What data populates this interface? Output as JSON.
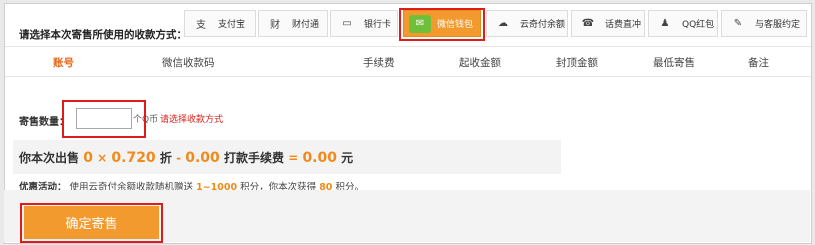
{
  "payment": {
    "label": "请选择本次寄售所使用的收款方式：",
    "options": [
      {
        "label": "支付宝",
        "icon": "alipay-icon",
        "glyph": "支"
      },
      {
        "label": "财付通",
        "icon": "tenpay-icon",
        "glyph": "财"
      },
      {
        "label": "银行卡",
        "icon": "bank-card-icon",
        "glyph": "▭"
      },
      {
        "label": "微信钱包",
        "icon": "wechat-wallet-icon",
        "glyph": "✉",
        "selected": true
      },
      {
        "label": "云奇付余额",
        "icon": "yunqifu-icon",
        "glyph": "☁"
      },
      {
        "label": "话费直冲",
        "icon": "phone-recharge-icon",
        "glyph": "☎"
      },
      {
        "label": "QQ红包",
        "icon": "qq-icon",
        "glyph": "♟"
      },
      {
        "label": "与客服约定",
        "icon": "customer-service-icon",
        "glyph": "✎"
      }
    ]
  },
  "table": {
    "headers": [
      "账号",
      "微信收款码",
      "手续费",
      "起收金额",
      "封顶金额",
      "最低寄售",
      "备注"
    ]
  },
  "quantity": {
    "label": "寄售数量：",
    "value": "",
    "unit": "个Q币",
    "hint": "请选择收款方式"
  },
  "summary": {
    "prefix": "你本次出售",
    "qty": "0",
    "times": "×",
    "discount": "0.720",
    "discount_unit": "折",
    "minus": "-",
    "fee": "0.00",
    "fee_label": "打款手续费",
    "equals": "=",
    "total": "0.00",
    "currency": "元"
  },
  "promo": {
    "label": "优惠活动：",
    "text_a": "使用云奇付余额收款随机赠送",
    "range": "1~1000",
    "text_b": "积分，你本次获得",
    "points": "80",
    "text_c": "积分。"
  },
  "confirm": {
    "label": "确定寄售"
  },
  "colors": {
    "accent": "#f39a2e",
    "highlight": "#f08a1b",
    "alert_red": "#e01b1b"
  }
}
